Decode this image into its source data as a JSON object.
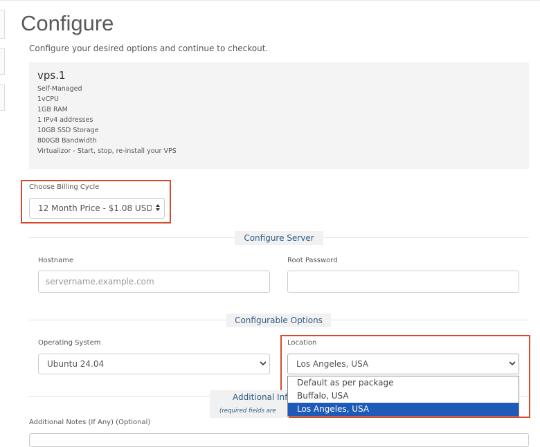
{
  "page": {
    "title": "Configure",
    "subtitle": "Configure your desired options and continue to checkout."
  },
  "product": {
    "name": "vps.1",
    "features": [
      "Self-Managed",
      "1vCPU",
      "1GB RAM",
      "1 IPv4 addresses",
      "10GB SSD Storage",
      "800GB Bandwidth",
      "Virtualizor - Start, stop, re-install your VPS"
    ]
  },
  "billing": {
    "label": "Choose Billing Cycle",
    "selected": "12 Month Price - $1.08 USD"
  },
  "configure_server": {
    "heading": "Configure Server",
    "hostname_label": "Hostname",
    "hostname_placeholder": "servername.example.com",
    "root_password_label": "Root Password",
    "root_password_value": ""
  },
  "configurable_options": {
    "heading": "Configurable Options",
    "os_label": "Operating System",
    "os_selected": "Ubuntu 24.04",
    "location_label": "Location",
    "location_selected": "Los Angeles, USA",
    "location_options": [
      "Default as per package",
      "Buffalo, USA",
      "Los Angeles, USA"
    ],
    "location_highlighted_index": 2
  },
  "additional": {
    "heading": "Additional Inf",
    "subheading": "(required fields are",
    "notes_label": "Additional Notes (If Any) (Optional)"
  },
  "colors": {
    "highlight_border": "#d54b2b",
    "selected_option_bg": "#1e5bb8",
    "section_heading": "#2f5d84"
  }
}
